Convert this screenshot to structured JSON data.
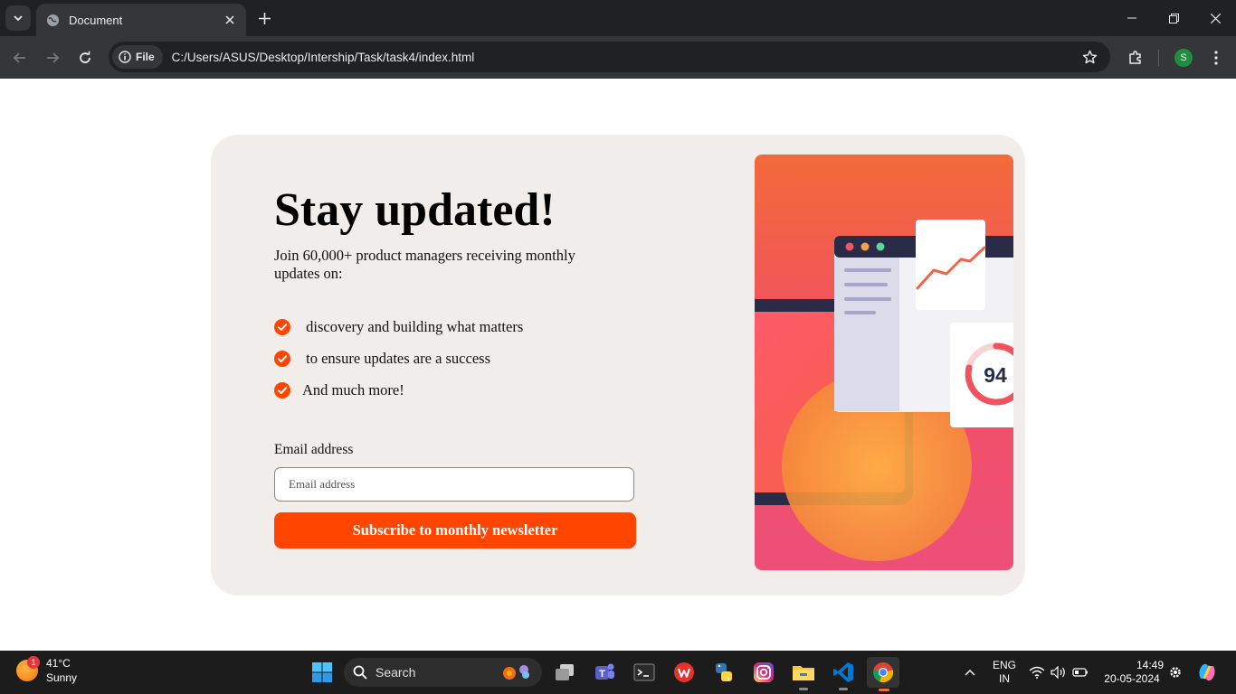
{
  "browser": {
    "tab_title": "Document",
    "chip_label": "File",
    "url": "C:/Users/ASUS/Desktop/Intership/Task/task4/index.html",
    "profile_initial": "S"
  },
  "card": {
    "headline": "Stay updated!",
    "intro": "Join 60,000+ product managers receiving monthly updates on:",
    "features": [
      " discovery and building what matters",
      " to ensure updates are a success",
      "And much more!"
    ],
    "email_label": "Email address",
    "email_placeholder": "Email address",
    "email_value": "",
    "subscribe_label": "Subscribe to monthly newsletter",
    "accent_color": "#ff4500",
    "illustration_score": "94"
  },
  "taskbar": {
    "weather_temp": "41°C",
    "weather_desc": "Sunny",
    "weather_badge": "1",
    "search_label": "Search",
    "lang_line1": "ENG",
    "lang_line2": "IN",
    "time": "14:49",
    "date": "20-05-2024"
  }
}
